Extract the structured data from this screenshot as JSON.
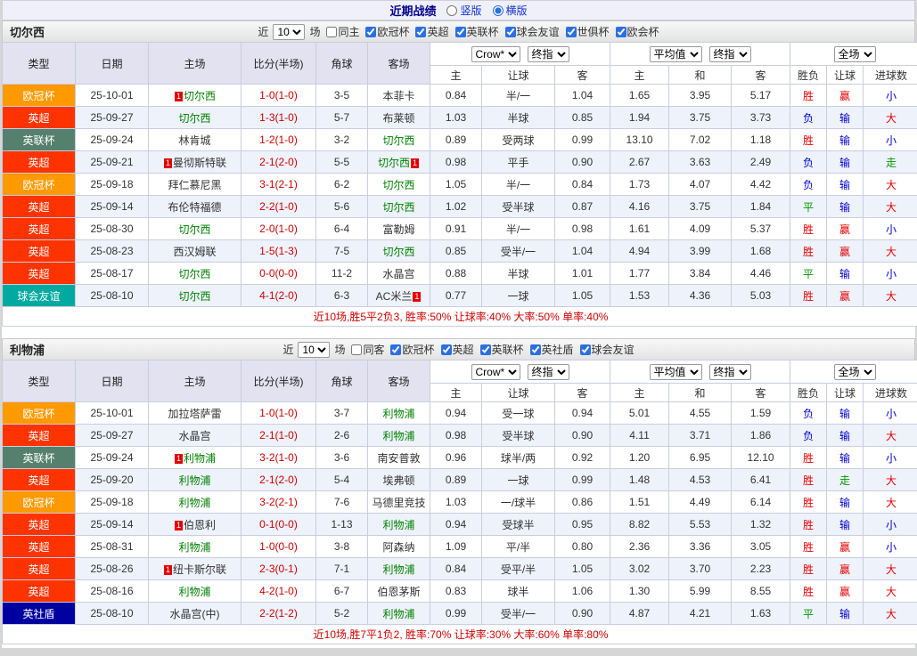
{
  "topbar": {
    "title": "近期战绩",
    "radios": [
      {
        "label": "竖版",
        "checked": false
      },
      {
        "label": "横版",
        "checked": true
      }
    ]
  },
  "colors": {
    "win": "#e60000",
    "loss": "#0000cc",
    "draw": "#009900",
    "score": "#cc0000",
    "self_team": "#008000",
    "summary": "#cc0000",
    "badge": "#e10000",
    "header_bg": "#e2e2f0",
    "alt_row_bg": "#eef2fb",
    "types": {
      "欧冠杯": "#ff9900",
      "英超": "#ff3300",
      "英联杯": "#55806e",
      "球会友谊": "#00aaa0",
      "英社盾": "#0000a0",
      "世俱杯": "#8888aa",
      "欧会杯": "#669933"
    }
  },
  "table_header": {
    "cols": [
      "类型",
      "日期",
      "主场",
      "比分(半场)",
      "角球",
      "客场"
    ],
    "groups": [
      {
        "selects": [
          "Crow*",
          "终指"
        ],
        "sub": [
          "主",
          "让球",
          "客"
        ]
      },
      {
        "selects": [
          "平均值",
          "终指"
        ],
        "sub": [
          "主",
          "和",
          "客"
        ]
      },
      {
        "selects": [
          "全场"
        ],
        "sub": [
          "胜负",
          "让球",
          "进球数"
        ]
      }
    ]
  },
  "sections": [
    {
      "team": "切尔西",
      "filter": {
        "near": "近",
        "count": "10",
        "games": "场",
        "venue": {
          "label": "同主",
          "checked": false
        },
        "competitions": [
          {
            "label": "欧冠杯",
            "checked": true
          },
          {
            "label": "英超",
            "checked": true
          },
          {
            "label": "英联杯",
            "checked": true
          },
          {
            "label": "球会友谊",
            "checked": true
          },
          {
            "label": "世俱杯",
            "checked": true
          },
          {
            "label": "欧会杯",
            "checked": true
          }
        ]
      },
      "rows": [
        {
          "type": "欧冠杯",
          "date": "25-10-01",
          "home": {
            "name": "切尔西",
            "self": true,
            "badge": "before"
          },
          "score": "1-0(1-0)",
          "corners": "3-5",
          "away": {
            "name": "本菲卡",
            "self": false,
            "badge": null
          },
          "odds": [
            "0.84",
            "半/一",
            "1.04",
            "1.65",
            "3.95",
            "5.17"
          ],
          "results": [
            {
              "t": "胜",
              "c": "r"
            },
            {
              "t": "赢",
              "c": "r"
            },
            {
              "t": "小",
              "c": "b"
            }
          ]
        },
        {
          "type": "英超",
          "date": "25-09-27",
          "home": {
            "name": "切尔西",
            "self": true,
            "badge": null
          },
          "score": "1-3(1-0)",
          "corners": "5-7",
          "away": {
            "name": "布莱顿",
            "self": false,
            "badge": null
          },
          "odds": [
            "1.03",
            "半球",
            "0.85",
            "1.94",
            "3.75",
            "3.73"
          ],
          "results": [
            {
              "t": "负",
              "c": "b"
            },
            {
              "t": "输",
              "c": "b"
            },
            {
              "t": "大",
              "c": "r"
            }
          ]
        },
        {
          "type": "英联杯",
          "date": "25-09-24",
          "home": {
            "name": "林肯城",
            "self": false,
            "badge": null
          },
          "score": "1-2(1-0)",
          "corners": "3-2",
          "away": {
            "name": "切尔西",
            "self": true,
            "badge": null
          },
          "odds": [
            "0.89",
            "受两球",
            "0.99",
            "13.10",
            "7.02",
            "1.18"
          ],
          "results": [
            {
              "t": "胜",
              "c": "r"
            },
            {
              "t": "输",
              "c": "b"
            },
            {
              "t": "小",
              "c": "b"
            }
          ]
        },
        {
          "type": "英超",
          "date": "25-09-21",
          "home": {
            "name": "曼彻斯特联",
            "self": false,
            "badge": "before"
          },
          "score": "2-1(2-0)",
          "corners": "5-5",
          "away": {
            "name": "切尔西",
            "self": true,
            "badge": "after"
          },
          "odds": [
            "0.98",
            "平手",
            "0.90",
            "2.67",
            "3.63",
            "2.49"
          ],
          "results": [
            {
              "t": "负",
              "c": "b"
            },
            {
              "t": "输",
              "c": "b"
            },
            {
              "t": "走",
              "c": "g"
            }
          ]
        },
        {
          "type": "欧冠杯",
          "date": "25-09-18",
          "home": {
            "name": "拜仁慕尼黑",
            "self": false,
            "badge": null
          },
          "score": "3-1(2-1)",
          "corners": "6-2",
          "away": {
            "name": "切尔西",
            "self": true,
            "badge": null
          },
          "odds": [
            "1.05",
            "半/一",
            "0.84",
            "1.73",
            "4.07",
            "4.42"
          ],
          "results": [
            {
              "t": "负",
              "c": "b"
            },
            {
              "t": "输",
              "c": "b"
            },
            {
              "t": "大",
              "c": "r"
            }
          ]
        },
        {
          "type": "英超",
          "date": "25-09-14",
          "home": {
            "name": "布伦特福德",
            "self": false,
            "badge": null
          },
          "score": "2-2(1-0)",
          "corners": "5-6",
          "away": {
            "name": "切尔西",
            "self": true,
            "badge": null
          },
          "odds": [
            "1.02",
            "受半球",
            "0.87",
            "4.16",
            "3.75",
            "1.84"
          ],
          "results": [
            {
              "t": "平",
              "c": "g"
            },
            {
              "t": "输",
              "c": "b"
            },
            {
              "t": "大",
              "c": "r"
            }
          ]
        },
        {
          "type": "英超",
          "date": "25-08-30",
          "home": {
            "name": "切尔西",
            "self": true,
            "badge": null
          },
          "score": "2-0(1-0)",
          "corners": "6-4",
          "away": {
            "name": "富勒姆",
            "self": false,
            "badge": null
          },
          "odds": [
            "0.91",
            "半/一",
            "0.98",
            "1.61",
            "4.09",
            "5.37"
          ],
          "results": [
            {
              "t": "胜",
              "c": "r"
            },
            {
              "t": "赢",
              "c": "r"
            },
            {
              "t": "小",
              "c": "b"
            }
          ]
        },
        {
          "type": "英超",
          "date": "25-08-23",
          "home": {
            "name": "西汉姆联",
            "self": false,
            "badge": null
          },
          "score": "1-5(1-3)",
          "corners": "7-5",
          "away": {
            "name": "切尔西",
            "self": true,
            "badge": null
          },
          "odds": [
            "0.85",
            "受半/一",
            "1.04",
            "4.94",
            "3.99",
            "1.68"
          ],
          "results": [
            {
              "t": "胜",
              "c": "r"
            },
            {
              "t": "赢",
              "c": "r"
            },
            {
              "t": "大",
              "c": "r"
            }
          ]
        },
        {
          "type": "英超",
          "date": "25-08-17",
          "home": {
            "name": "切尔西",
            "self": true,
            "badge": null
          },
          "score": "0-0(0-0)",
          "corners": "11-2",
          "away": {
            "name": "水晶宫",
            "self": false,
            "badge": null
          },
          "odds": [
            "0.88",
            "半球",
            "1.01",
            "1.77",
            "3.84",
            "4.46"
          ],
          "results": [
            {
              "t": "平",
              "c": "g"
            },
            {
              "t": "输",
              "c": "b"
            },
            {
              "t": "小",
              "c": "b"
            }
          ]
        },
        {
          "type": "球会友谊",
          "date": "25-08-10",
          "home": {
            "name": "切尔西",
            "self": true,
            "badge": null
          },
          "score": "4-1(2-0)",
          "corners": "6-3",
          "away": {
            "name": "AC米兰",
            "self": false,
            "badge": "after"
          },
          "odds": [
            "0.77",
            "一球",
            "1.05",
            "1.53",
            "4.36",
            "5.03"
          ],
          "results": [
            {
              "t": "胜",
              "c": "r"
            },
            {
              "t": "赢",
              "c": "r"
            },
            {
              "t": "大",
              "c": "r"
            }
          ]
        }
      ],
      "summary": "近10场,胜5平2负3, 胜率:50% 让球率:40% 大率:50% 单率:40%"
    },
    {
      "team": "利物浦",
      "filter": {
        "near": "近",
        "count": "10",
        "games": "场",
        "venue": {
          "label": "同客",
          "checked": false
        },
        "competitions": [
          {
            "label": "欧冠杯",
            "checked": true
          },
          {
            "label": "英超",
            "checked": true
          },
          {
            "label": "英联杯",
            "checked": true
          },
          {
            "label": "英社盾",
            "checked": true
          },
          {
            "label": "球会友谊",
            "checked": true
          }
        ]
      },
      "rows": [
        {
          "type": "欧冠杯",
          "date": "25-10-01",
          "home": {
            "name": "加拉塔萨雷",
            "self": false,
            "badge": null
          },
          "score": "1-0(1-0)",
          "corners": "3-7",
          "away": {
            "name": "利物浦",
            "self": true,
            "badge": null
          },
          "odds": [
            "0.94",
            "受一球",
            "0.94",
            "5.01",
            "4.55",
            "1.59"
          ],
          "results": [
            {
              "t": "负",
              "c": "b"
            },
            {
              "t": "输",
              "c": "b"
            },
            {
              "t": "小",
              "c": "b"
            }
          ]
        },
        {
          "type": "英超",
          "date": "25-09-27",
          "home": {
            "name": "水晶宫",
            "self": false,
            "badge": null
          },
          "score": "2-1(1-0)",
          "corners": "2-6",
          "away": {
            "name": "利物浦",
            "self": true,
            "badge": null
          },
          "odds": [
            "0.98",
            "受半球",
            "0.90",
            "4.11",
            "3.71",
            "1.86"
          ],
          "results": [
            {
              "t": "负",
              "c": "b"
            },
            {
              "t": "输",
              "c": "b"
            },
            {
              "t": "大",
              "c": "r"
            }
          ]
        },
        {
          "type": "英联杯",
          "date": "25-09-24",
          "home": {
            "name": "利物浦",
            "self": true,
            "badge": "before"
          },
          "score": "3-2(1-0)",
          "corners": "3-6",
          "away": {
            "name": "南安普敦",
            "self": false,
            "badge": null
          },
          "odds": [
            "0.96",
            "球半/两",
            "0.92",
            "1.20",
            "6.95",
            "12.10"
          ],
          "results": [
            {
              "t": "胜",
              "c": "r"
            },
            {
              "t": "输",
              "c": "b"
            },
            {
              "t": "小",
              "c": "b"
            }
          ]
        },
        {
          "type": "英超",
          "date": "25-09-20",
          "home": {
            "name": "利物浦",
            "self": true,
            "badge": null
          },
          "score": "2-1(2-0)",
          "corners": "5-4",
          "away": {
            "name": "埃弗顿",
            "self": false,
            "badge": null
          },
          "odds": [
            "0.89",
            "一球",
            "0.99",
            "1.48",
            "4.53",
            "6.41"
          ],
          "results": [
            {
              "t": "胜",
              "c": "r"
            },
            {
              "t": "走",
              "c": "g"
            },
            {
              "t": "大",
              "c": "r"
            }
          ]
        },
        {
          "type": "欧冠杯",
          "date": "25-09-18",
          "home": {
            "name": "利物浦",
            "self": true,
            "badge": null
          },
          "score": "3-2(2-1)",
          "corners": "7-6",
          "away": {
            "name": "马德里竞技",
            "self": false,
            "badge": null
          },
          "odds": [
            "1.03",
            "一/球半",
            "0.86",
            "1.51",
            "4.49",
            "6.14"
          ],
          "results": [
            {
              "t": "胜",
              "c": "r"
            },
            {
              "t": "输",
              "c": "b"
            },
            {
              "t": "大",
              "c": "r"
            }
          ]
        },
        {
          "type": "英超",
          "date": "25-09-14",
          "home": {
            "name": "伯恩利",
            "self": false,
            "badge": "before"
          },
          "score": "0-1(0-0)",
          "corners": "1-13",
          "away": {
            "name": "利物浦",
            "self": true,
            "badge": null
          },
          "odds": [
            "0.94",
            "受球半",
            "0.95",
            "8.82",
            "5.53",
            "1.32"
          ],
          "results": [
            {
              "t": "胜",
              "c": "r"
            },
            {
              "t": "输",
              "c": "b"
            },
            {
              "t": "小",
              "c": "b"
            }
          ]
        },
        {
          "type": "英超",
          "date": "25-08-31",
          "home": {
            "name": "利物浦",
            "self": true,
            "badge": null
          },
          "score": "1-0(0-0)",
          "corners": "3-8",
          "away": {
            "name": "阿森纳",
            "self": false,
            "badge": null
          },
          "odds": [
            "1.09",
            "平/半",
            "0.80",
            "2.36",
            "3.36",
            "3.05"
          ],
          "results": [
            {
              "t": "胜",
              "c": "r"
            },
            {
              "t": "赢",
              "c": "r"
            },
            {
              "t": "小",
              "c": "b"
            }
          ]
        },
        {
          "type": "英超",
          "date": "25-08-26",
          "home": {
            "name": "纽卡斯尔联",
            "self": false,
            "badge": "before"
          },
          "score": "2-3(0-1)",
          "corners": "7-1",
          "away": {
            "name": "利物浦",
            "self": true,
            "badge": null
          },
          "odds": [
            "0.84",
            "受平/半",
            "1.05",
            "3.02",
            "3.70",
            "2.23"
          ],
          "results": [
            {
              "t": "胜",
              "c": "r"
            },
            {
              "t": "赢",
              "c": "r"
            },
            {
              "t": "大",
              "c": "r"
            }
          ]
        },
        {
          "type": "英超",
          "date": "25-08-16",
          "home": {
            "name": "利物浦",
            "self": true,
            "badge": null
          },
          "score": "4-2(1-0)",
          "corners": "6-7",
          "away": {
            "name": "伯恩茅斯",
            "self": false,
            "badge": null
          },
          "odds": [
            "0.83",
            "球半",
            "1.06",
            "1.30",
            "5.99",
            "8.55"
          ],
          "results": [
            {
              "t": "胜",
              "c": "r"
            },
            {
              "t": "赢",
              "c": "r"
            },
            {
              "t": "大",
              "c": "r"
            }
          ]
        },
        {
          "type": "英社盾",
          "date": "25-08-10",
          "home": {
            "name": "水晶宫(中)",
            "self": false,
            "badge": null
          },
          "score": "2-2(1-2)",
          "corners": "5-2",
          "away": {
            "name": "利物浦",
            "self": true,
            "badge": null
          },
          "odds": [
            "0.99",
            "受半/一",
            "0.90",
            "4.87",
            "4.21",
            "1.63"
          ],
          "results": [
            {
              "t": "平",
              "c": "g"
            },
            {
              "t": "输",
              "c": "b"
            },
            {
              "t": "大",
              "c": "r"
            }
          ]
        }
      ],
      "summary": "近10场,胜7平1负2, 胜率:70% 让球率:30% 大率:60% 单率:80%"
    }
  ]
}
